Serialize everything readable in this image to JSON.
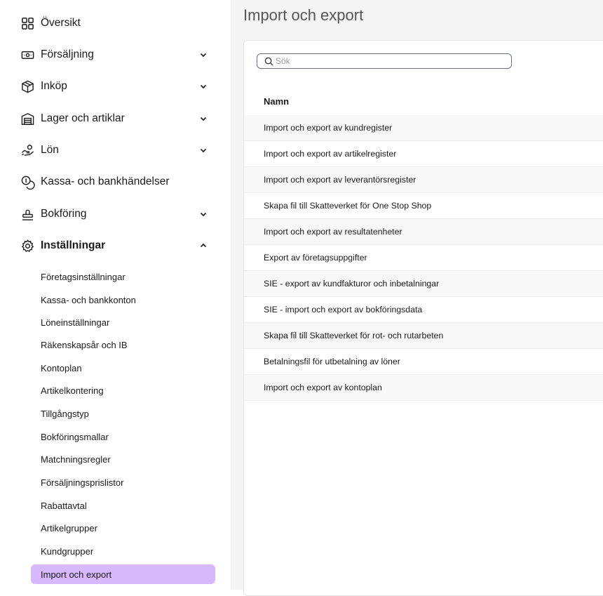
{
  "sidebar": {
    "main": [
      {
        "label": "Översikt"
      },
      {
        "label": "Försäljning"
      },
      {
        "label": "Inköp"
      },
      {
        "label": "Lager och artiklar"
      },
      {
        "label": "Lön"
      },
      {
        "label": "Kassa- och bankhändelser"
      },
      {
        "label": "Bokföring"
      },
      {
        "label": "Inställningar"
      }
    ],
    "sub": [
      {
        "label": "Företagsinställningar"
      },
      {
        "label": "Kassa- och bankkonton"
      },
      {
        "label": "Löneinställningar"
      },
      {
        "label": "Räkenskapsår och IB"
      },
      {
        "label": "Kontoplan"
      },
      {
        "label": "Artikelkontering"
      },
      {
        "label": "Tillgångstyp"
      },
      {
        "label": "Bokföringsmallar"
      },
      {
        "label": "Matchningsregler"
      },
      {
        "label": "Försäljningsprislistor"
      },
      {
        "label": "Rabattavtal"
      },
      {
        "label": "Artikelgrupper"
      },
      {
        "label": "Kundgrupper"
      },
      {
        "label": "Import och export"
      }
    ],
    "active_sub": "Import och export",
    "accent_color": "#d6b8fb"
  },
  "page": {
    "title": "Import och export"
  },
  "search": {
    "placeholder": "Sök",
    "value": ""
  },
  "table": {
    "column_header": "Namn",
    "rows": [
      "Import och export av kundregister",
      "Import och export av artikelregister",
      "Import och export av leverantörsregister",
      "Skapa fil till Skatteverket för One Stop Shop",
      "Import och export av resultatenheter",
      "Export av företagsuppgifter",
      "SIE - export av kundfakturor och inbetalningar",
      "SIE - import och export av bokföringsdata",
      "Skapa fil till Skatteverket för rot- och rutarbeten",
      "Betalningsfil för utbetalning av löner",
      "Import och export av kontoplan"
    ]
  }
}
